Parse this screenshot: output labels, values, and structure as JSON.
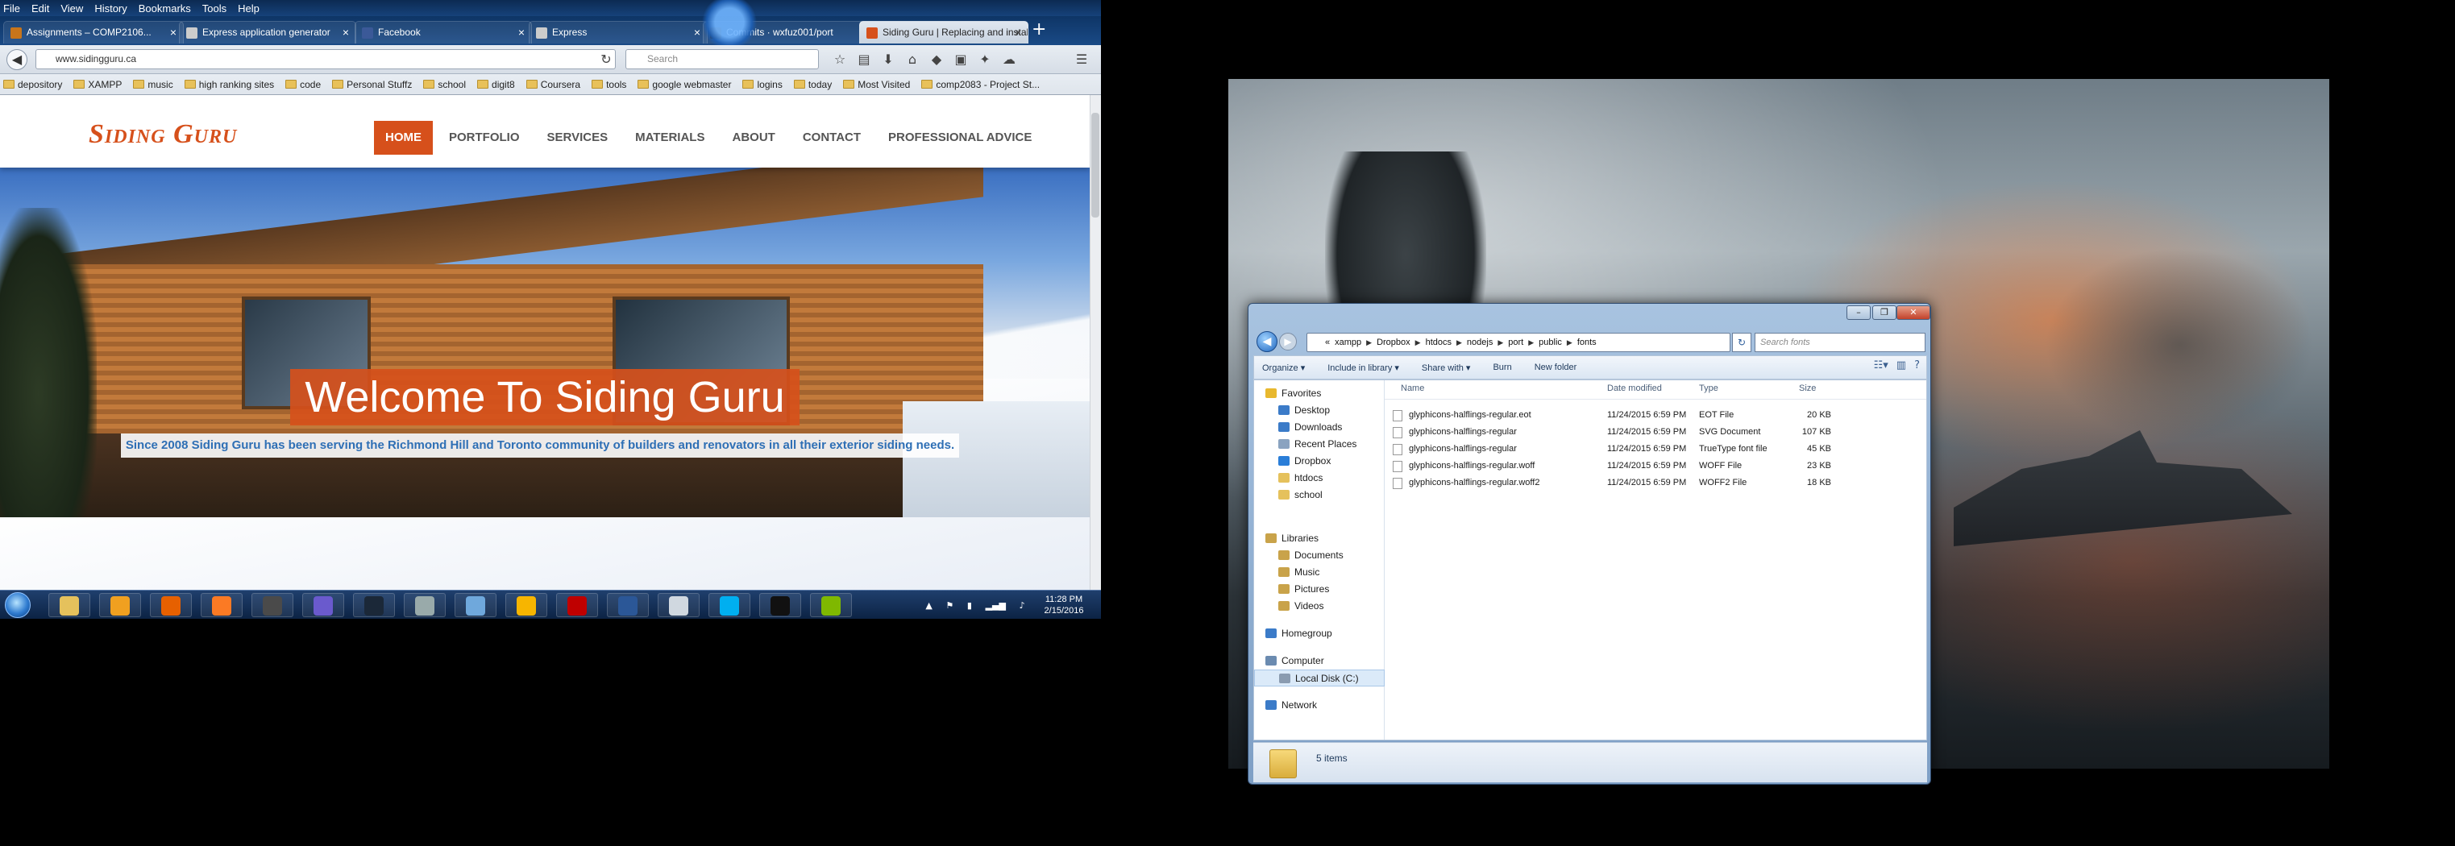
{
  "firefox": {
    "menu": [
      "File",
      "Edit",
      "View",
      "History",
      "Bookmarks",
      "Tools",
      "Help"
    ],
    "tabs": [
      {
        "label": "Assignments – COMP2106...",
        "favicon_color": "#c8751b"
      },
      {
        "label": "Express application generator",
        "favicon_color": "#cccccc"
      },
      {
        "label": "Facebook",
        "favicon_color": "#3b5998"
      },
      {
        "label": "Express",
        "favicon_color": "#cccccc"
      },
      {
        "label": "Commits · wxfuz001/port",
        "favicon_color": "#333333"
      },
      {
        "label": "Siding Guru | Replacing and installi...",
        "favicon_color": "#d6501b"
      }
    ],
    "new_tab": "+",
    "url": "www.sidingguru.ca",
    "search_placeholder": "Search",
    "bookmarks": [
      "depository",
      "XAMPP",
      "music",
      "high ranking sites",
      "code",
      "Personal Stuffz",
      "school",
      "digit8",
      "Coursera",
      "tools",
      "google webmaster",
      "logins",
      "today",
      "Most Visited",
      "comp2083 - Project St..."
    ]
  },
  "site": {
    "logo": "Siding Guru",
    "nav": [
      "HOME",
      "PORTFOLIO",
      "SERVICES",
      "MATERIALS",
      "ABOUT",
      "CONTACT",
      "PROFESSIONAL ADVICE"
    ],
    "headline": "Welcome To Siding Guru",
    "tagline": "Since 2008 Siding Guru has been serving the Richmond Hill and Toronto community of builders and renovators in all their exterior siding needs.",
    "accent_color": "#d6501b"
  },
  "taskbar": {
    "apps": [
      {
        "name": "explorer",
        "color": "#e5c15c"
      },
      {
        "name": "media-player",
        "color": "#f0a020"
      },
      {
        "name": "firefox",
        "color": "#e66000"
      },
      {
        "name": "xampp",
        "color": "#fb7a24"
      },
      {
        "name": "sublime",
        "color": "#4a4a4a"
      },
      {
        "name": "app-purple",
        "color": "#6a5acd"
      },
      {
        "name": "steam",
        "color": "#1b2838"
      },
      {
        "name": "app-gear",
        "color": "#9aa"
      },
      {
        "name": "app-book",
        "color": "#6fa8dc"
      },
      {
        "name": "webstorm",
        "color": "#f7b500"
      },
      {
        "name": "filezilla",
        "color": "#bf0000"
      },
      {
        "name": "app-network",
        "color": "#2b5797"
      },
      {
        "name": "notepad",
        "color": "#d0d8e0"
      },
      {
        "name": "skype",
        "color": "#00aff0"
      },
      {
        "name": "cmd",
        "color": "#111111"
      },
      {
        "name": "app-green",
        "color": "#7fb800"
      }
    ],
    "time": "11:28 PM",
    "date": "2/15/2016"
  },
  "explorer": {
    "window_buttons": [
      "–",
      "❐",
      "✕"
    ],
    "path": [
      "«",
      "xampp",
      "Dropbox",
      "htdocs",
      "nodejs",
      "port",
      "public",
      "fonts"
    ],
    "search_placeholder": "Search fonts",
    "commands": [
      "Organize ▾",
      "Include in library ▾",
      "Share with ▾",
      "Burn",
      "New folder"
    ],
    "sidebar": [
      {
        "label": "Favorites",
        "kind": "top",
        "icon": "star-icon",
        "color": "#e8b82e"
      },
      {
        "label": "Desktop",
        "kind": "sub",
        "icon": "desktop-icon",
        "color": "#3b7bc8"
      },
      {
        "label": "Downloads",
        "kind": "sub",
        "icon": "downloads-icon",
        "color": "#3b7bc8"
      },
      {
        "label": "Recent Places",
        "kind": "sub",
        "icon": "recent-icon",
        "color": "#8aa3c0"
      },
      {
        "label": "Dropbox",
        "kind": "sub",
        "icon": "dropbox-icon",
        "color": "#2a7ed8"
      },
      {
        "label": "htdocs",
        "kind": "sub",
        "icon": "folder-icon",
        "color": "#e5c15c"
      },
      {
        "label": "school",
        "kind": "sub",
        "icon": "folder-icon",
        "color": "#e5c15c"
      },
      {
        "label": "Libraries",
        "kind": "top",
        "icon": "library-icon",
        "color": "#c9a34a"
      },
      {
        "label": "Documents",
        "kind": "sub",
        "icon": "documents-icon",
        "color": "#c9a34a"
      },
      {
        "label": "Music",
        "kind": "sub",
        "icon": "music-icon",
        "color": "#c9a34a"
      },
      {
        "label": "Pictures",
        "kind": "sub",
        "icon": "pictures-icon",
        "color": "#c9a34a"
      },
      {
        "label": "Videos",
        "kind": "sub",
        "icon": "videos-icon",
        "color": "#c9a34a"
      },
      {
        "label": "Homegroup",
        "kind": "top",
        "icon": "homegroup-icon",
        "color": "#3b7bc8"
      },
      {
        "label": "Computer",
        "kind": "top",
        "icon": "computer-icon",
        "color": "#6b8bb0"
      },
      {
        "label": "Local Disk (C:)",
        "kind": "sub",
        "icon": "disk-icon",
        "color": "#8a9bb0"
      },
      {
        "label": "Network",
        "kind": "top",
        "icon": "network-icon",
        "color": "#3b7bc8"
      }
    ],
    "columns": [
      "Name",
      "Date modified",
      "Type",
      "Size"
    ],
    "files": [
      {
        "name": "glyphicons-halflings-regular.eot",
        "date": "11/24/2015 6:59 PM",
        "type": "EOT File",
        "size": "20 KB"
      },
      {
        "name": "glyphicons-halflings-regular",
        "date": "11/24/2015 6:59 PM",
        "type": "SVG Document",
        "size": "107 KB"
      },
      {
        "name": "glyphicons-halflings-regular",
        "date": "11/24/2015 6:59 PM",
        "type": "TrueType font file",
        "size": "45 KB"
      },
      {
        "name": "glyphicons-halflings-regular.woff",
        "date": "11/24/2015 6:59 PM",
        "type": "WOFF File",
        "size": "23 KB"
      },
      {
        "name": "glyphicons-halflings-regular.woff2",
        "date": "11/24/2015 6:59 PM",
        "type": "WOFF2 File",
        "size": "18 KB"
      }
    ],
    "item_count": "5 items"
  }
}
